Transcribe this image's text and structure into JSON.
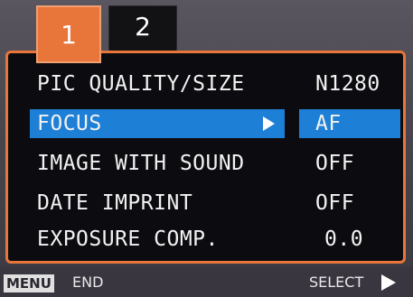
{
  "tabs": [
    {
      "label": "1",
      "active": true
    },
    {
      "label": "2",
      "active": false
    }
  ],
  "menu": {
    "items": [
      {
        "label": "PIC QUALITY/SIZE",
        "value": "N1280",
        "selected": false
      },
      {
        "label": "FOCUS",
        "value": "AF",
        "selected": true
      },
      {
        "label": "IMAGE WITH SOUND",
        "value": "OFF",
        "selected": false
      },
      {
        "label": "DATE IMPRINT",
        "value": "OFF",
        "selected": false
      },
      {
        "label": "EXPOSURE COMP.",
        "value": "0.0",
        "selected": false
      }
    ]
  },
  "footer": {
    "menu_key": "MENU",
    "end_label": "END",
    "select_label": "SELECT",
    "select_icon": "right-triangle-icon"
  },
  "colors": {
    "accent": "#e8753a",
    "highlight": "#1e7fd6",
    "panel_bg": "#0c0c10",
    "text": "#f2f2f2"
  }
}
